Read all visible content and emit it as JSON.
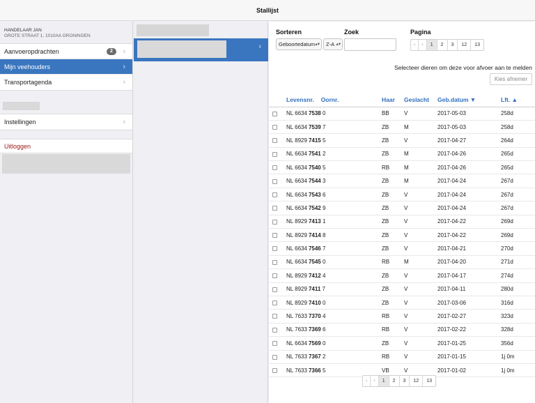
{
  "title": "Stallijst",
  "sidebar": {
    "dealer_name": "HANDELAAR JAN",
    "dealer_address": "GROTE STRAAT 1, 1010AA GRONINGEN",
    "items": [
      {
        "label": "Aanvoeropdrachten",
        "badge": "2",
        "active": false
      },
      {
        "label": "Mijn veehouders",
        "active": true
      },
      {
        "label": "Transportagenda",
        "active": false
      }
    ],
    "settings_label": "Instellingen",
    "logout_label": "Uitloggen"
  },
  "controls": {
    "sort_label": "Sorteren",
    "sort_field": "Geboortedatum",
    "sort_order": "Z-A",
    "search_label": "Zoek",
    "search_value": "",
    "page_label": "Pagina",
    "pages": [
      "1",
      "2",
      "3",
      "12",
      "13"
    ],
    "current_page": "1",
    "first_icon": "‹",
    "prev_icon": "‹",
    "notice": "Selecteer dieren om deze voor afvoer aan te melden",
    "choose_button": "Kies afnemer"
  },
  "table": {
    "headers": {
      "levensnr": "Levensnr.",
      "ornr": "Oornr.",
      "haar": "Haar",
      "geslacht": "Geslacht",
      "gebdatum": "Geb.datum ▼",
      "lft": "Lft. ▲"
    },
    "rows": [
      {
        "prefix": "NL 6634",
        "nr": "7538",
        "check": "0",
        "haar": "BB",
        "geslacht": "V",
        "datum": "2017-05-03",
        "lft": "258d"
      },
      {
        "prefix": "NL 6634",
        "nr": "7539",
        "check": "7",
        "haar": "ZB",
        "geslacht": "M",
        "datum": "2017-05-03",
        "lft": "258d"
      },
      {
        "prefix": "NL 8929",
        "nr": "7415",
        "check": "5",
        "haar": "ZB",
        "geslacht": "V",
        "datum": "2017-04-27",
        "lft": "264d"
      },
      {
        "prefix": "NL 6634",
        "nr": "7541",
        "check": "2",
        "haar": "ZB",
        "geslacht": "M",
        "datum": "2017-04-26",
        "lft": "265d"
      },
      {
        "prefix": "NL 6634",
        "nr": "7540",
        "check": "5",
        "haar": "RB",
        "geslacht": "M",
        "datum": "2017-04-26",
        "lft": "265d"
      },
      {
        "prefix": "NL 6634",
        "nr": "7544",
        "check": "3",
        "haar": "ZB",
        "geslacht": "M",
        "datum": "2017-04-24",
        "lft": "267d"
      },
      {
        "prefix": "NL 6634",
        "nr": "7543",
        "check": "6",
        "haar": "ZB",
        "geslacht": "V",
        "datum": "2017-04-24",
        "lft": "267d"
      },
      {
        "prefix": "NL 6634",
        "nr": "7542",
        "check": "9",
        "haar": "ZB",
        "geslacht": "V",
        "datum": "2017-04-24",
        "lft": "267d"
      },
      {
        "prefix": "NL 8929",
        "nr": "7413",
        "check": "1",
        "haar": "ZB",
        "geslacht": "V",
        "datum": "2017-04-22",
        "lft": "269d"
      },
      {
        "prefix": "NL 8929",
        "nr": "7414",
        "check": "8",
        "haar": "ZB",
        "geslacht": "V",
        "datum": "2017-04-22",
        "lft": "269d"
      },
      {
        "prefix": "NL 6634",
        "nr": "7546",
        "check": "7",
        "haar": "ZB",
        "geslacht": "V",
        "datum": "2017-04-21",
        "lft": "270d"
      },
      {
        "prefix": "NL 6634",
        "nr": "7545",
        "check": "0",
        "haar": "RB",
        "geslacht": "M",
        "datum": "2017-04-20",
        "lft": "271d"
      },
      {
        "prefix": "NL 8929",
        "nr": "7412",
        "check": "4",
        "haar": "ZB",
        "geslacht": "V",
        "datum": "2017-04-17",
        "lft": "274d"
      },
      {
        "prefix": "NL 8929",
        "nr": "7411",
        "check": "7",
        "haar": "ZB",
        "geslacht": "V",
        "datum": "2017-04-11",
        "lft": "280d"
      },
      {
        "prefix": "NL 8929",
        "nr": "7410",
        "check": "0",
        "haar": "ZB",
        "geslacht": "V",
        "datum": "2017-03-06",
        "lft": "316d"
      },
      {
        "prefix": "NL 7633",
        "nr": "7370",
        "check": "4",
        "haar": "RB",
        "geslacht": "V",
        "datum": "2017-02-27",
        "lft": "323d"
      },
      {
        "prefix": "NL 7633",
        "nr": "7369",
        "check": "6",
        "haar": "RB",
        "geslacht": "V",
        "datum": "2017-02-22",
        "lft": "328d"
      },
      {
        "prefix": "NL 6634",
        "nr": "7569",
        "check": "0",
        "haar": "ZB",
        "geslacht": "V",
        "datum": "2017-01-25",
        "lft": "356d"
      },
      {
        "prefix": "NL 7633",
        "nr": "7367",
        "check": "2",
        "haar": "RB",
        "geslacht": "V",
        "datum": "2017-01-15",
        "lft": "1j 0m"
      },
      {
        "prefix": "NL 7633",
        "nr": "7366",
        "check": "5",
        "haar": "VB",
        "geslacht": "V",
        "datum": "2017-01-02",
        "lft": "1j 0m"
      }
    ]
  },
  "colors": {
    "accent": "#3a76bf",
    "header_text": "#2f6fbf",
    "logout": "#a01c1c"
  }
}
